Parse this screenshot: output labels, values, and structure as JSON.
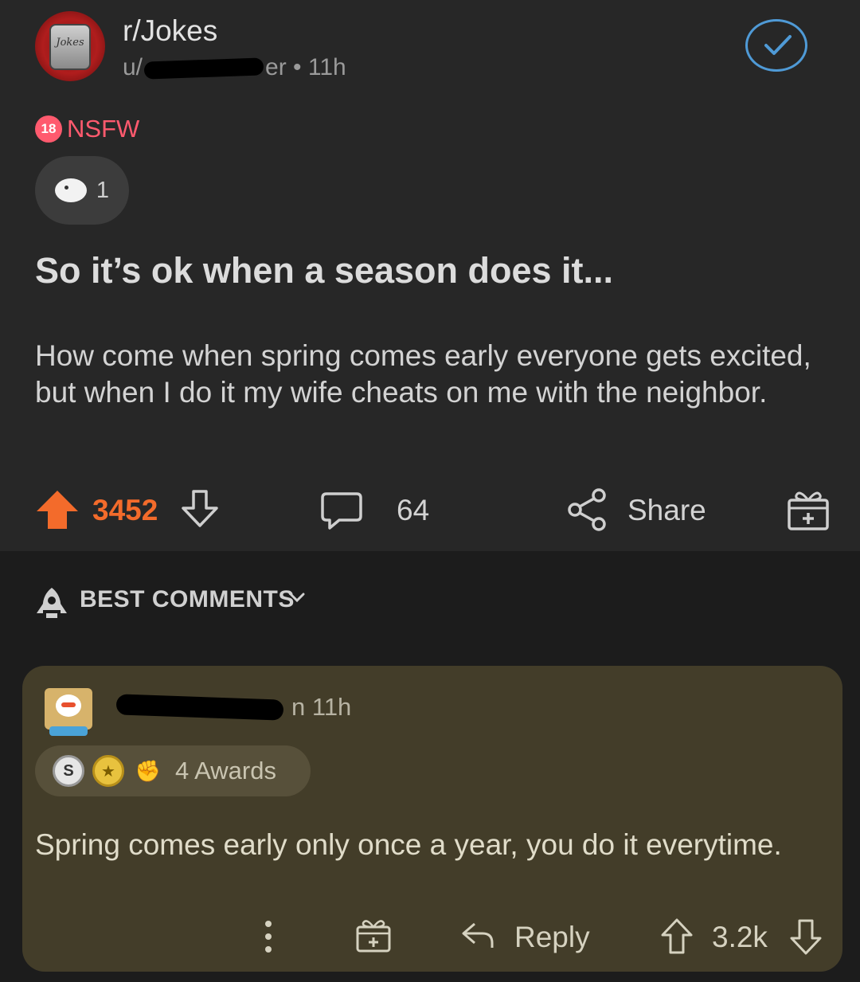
{
  "post": {
    "subreddit": "r/Jokes",
    "subreddit_logo_text": "Jokes",
    "user_prefix": "u/",
    "user_suffix": "er",
    "time": " • 11h",
    "nsfw_badge": "18",
    "nsfw_label": "NSFW",
    "award_count": "1",
    "title": "So it’s ok when a season does it...",
    "body": "How come when spring comes early everyone gets excited, but when I do it my wife cheats on me with the neighbor.",
    "score": "3452",
    "comment_count": "64",
    "share_label": "Share"
  },
  "sort": {
    "label": "BEST COMMENTS"
  },
  "comment": {
    "user_suffix": "n",
    "time": "11h",
    "awards_label": "4 Awards",
    "body": "Spring comes early only once a year, you do it everytime.",
    "reply_label": "Reply",
    "score": "3.2k"
  },
  "colors": {
    "upvote": "#f36b2b",
    "nsfw": "#ff5a6e",
    "accent_blue": "#4f9ad6",
    "comment_bg": "#433d29",
    "post_bg": "#272727"
  },
  "icons": [
    "subreddit-logo",
    "check-icon",
    "upvote-arrow-icon",
    "downvote-arrow-icon",
    "comment-bubble-icon",
    "share-icon",
    "gift-icon",
    "rocket-icon",
    "chevron-down-icon",
    "more-icon",
    "reply-arrow-icon"
  ]
}
